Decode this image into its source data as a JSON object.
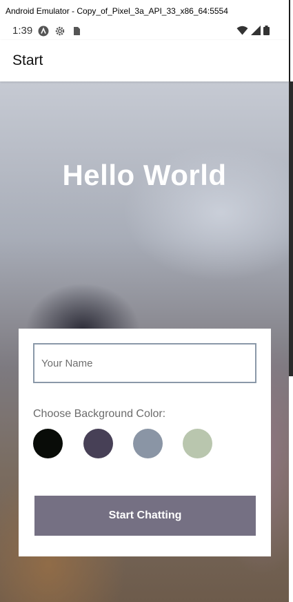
{
  "window": {
    "title": "Android Emulator - Copy_of_Pixel_3a_API_33_x86_64:5554"
  },
  "status_bar": {
    "time": "1:39",
    "left_icons": [
      "android-auto-icon",
      "settings-gear-icon",
      "sd-card-icon"
    ],
    "right_icons": [
      "wifi-icon",
      "cell-signal-icon",
      "battery-icon"
    ]
  },
  "app_bar": {
    "title": "Start"
  },
  "hero": {
    "title": "Hello World"
  },
  "form": {
    "name_placeholder": "Your Name",
    "name_value": "",
    "color_label": "Choose Background Color:",
    "colors": [
      "#090C08",
      "#474056",
      "#8A95A5",
      "#B9C6AE"
    ],
    "button_label": "Start Chatting",
    "button_color": "#757083"
  }
}
